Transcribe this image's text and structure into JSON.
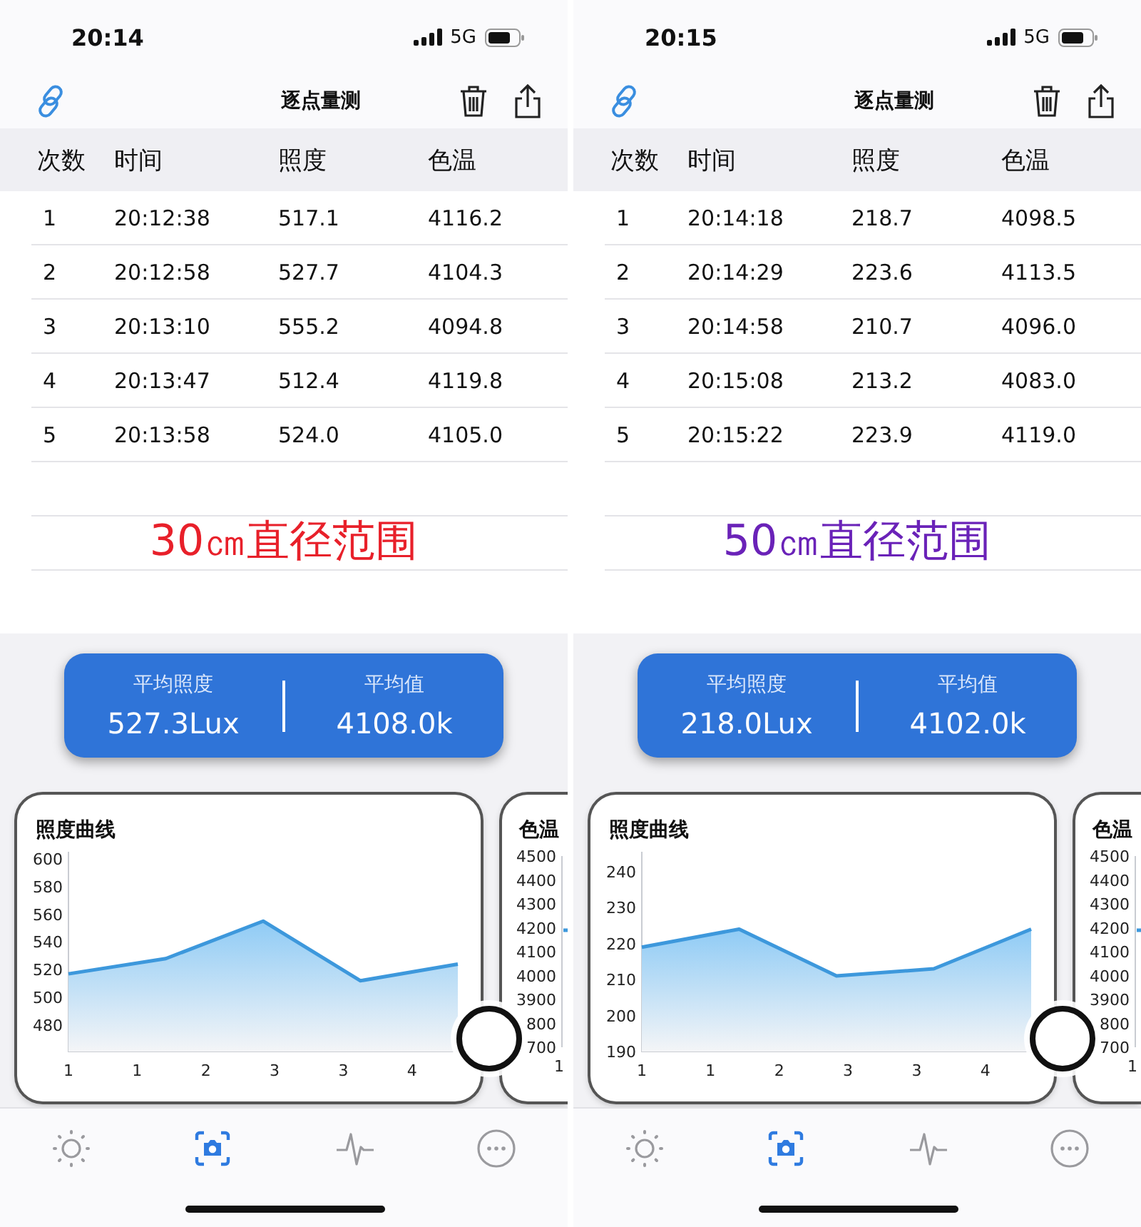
{
  "phones": [
    {
      "status": {
        "time": "20:14",
        "network": "5G"
      },
      "nav": {
        "title": "逐点量测"
      },
      "table": {
        "columns": [
          "次数",
          "时间",
          "照度",
          "色温"
        ],
        "rows": [
          [
            "1",
            "20:12:38",
            "517.1",
            "4116.2"
          ],
          [
            "2",
            "20:12:58",
            "527.7",
            "4104.3"
          ],
          [
            "3",
            "20:13:10",
            "555.2",
            "4094.8"
          ],
          [
            "4",
            "20:13:47",
            "512.4",
            "4119.8"
          ],
          [
            "5",
            "20:13:58",
            "524.0",
            "4105.0"
          ]
        ]
      },
      "caption": {
        "text": "30㎝直径范围",
        "color": "#e8202a"
      },
      "summary": [
        {
          "label": "平均照度",
          "value": "527.3Lux"
        },
        {
          "label": "平均值",
          "value": "4108.0k"
        }
      ],
      "cards": [
        {
          "title": "照度曲线",
          "chart_data": {
            "type": "area",
            "x": [
              0.8,
              1.65,
              2.5,
              3.35,
              4.2
            ],
            "values": [
              517,
              528,
              555,
              512,
              524
            ],
            "xlim": [
              0.8,
              4.2
            ],
            "ylim": [
              461,
              605
            ],
            "xticks": [
              {
                "value": 0.8,
                "label": "1"
              },
              {
                "value": 1.4,
                "label": "1"
              },
              {
                "value": 2.0,
                "label": "2"
              },
              {
                "value": 2.6,
                "label": "3"
              },
              {
                "value": 3.2,
                "label": "3"
              },
              {
                "value": 3.8,
                "label": "4"
              }
            ],
            "yticks": [
              480,
              500,
              520,
              540,
              560,
              580,
              600
            ]
          }
        },
        {
          "title": "色温",
          "axis_labels": [
            "4500",
            "4400",
            "4300",
            "4200",
            "4100",
            "4000",
            "3900",
            "800",
            "700"
          ],
          "x_label": "1"
        }
      ],
      "tabs": [
        {
          "kind": "sun",
          "selected": false
        },
        {
          "kind": "camera",
          "selected": true
        },
        {
          "kind": "pulse",
          "selected": false
        },
        {
          "kind": "more",
          "selected": false
        }
      ]
    },
    {
      "status": {
        "time": "20:15",
        "network": "5G"
      },
      "nav": {
        "title": "逐点量测"
      },
      "table": {
        "columns": [
          "次数",
          "时间",
          "照度",
          "色温"
        ],
        "rows": [
          [
            "1",
            "20:14:18",
            "218.7",
            "4098.5"
          ],
          [
            "2",
            "20:14:29",
            "223.6",
            "4113.5"
          ],
          [
            "3",
            "20:14:58",
            "210.7",
            "4096.0"
          ],
          [
            "4",
            "20:15:08",
            "213.2",
            "4083.0"
          ],
          [
            "5",
            "20:15:22",
            "223.9",
            "4119.0"
          ]
        ]
      },
      "caption": {
        "text": "50㎝直径范围",
        "color": "#6a22b8"
      },
      "summary": [
        {
          "label": "平均照度",
          "value": "218.0Lux"
        },
        {
          "label": "平均值",
          "value": "4102.0k"
        }
      ],
      "cards": [
        {
          "title": "照度曲线",
          "chart_data": {
            "type": "area",
            "x": [
              0.8,
              1.65,
              2.5,
              3.35,
              4.2
            ],
            "values": [
              219,
              224,
              211,
              213,
              224
            ],
            "xlim": [
              0.8,
              4.2
            ],
            "ylim": [
              190,
              245.5
            ],
            "xticks": [
              {
                "value": 0.8,
                "label": "1"
              },
              {
                "value": 1.4,
                "label": "1"
              },
              {
                "value": 2.0,
                "label": "2"
              },
              {
                "value": 2.6,
                "label": "3"
              },
              {
                "value": 3.2,
                "label": "3"
              },
              {
                "value": 3.8,
                "label": "4"
              }
            ],
            "yticks": [
              190,
              200,
              210,
              220,
              230,
              240
            ]
          }
        },
        {
          "title": "色温",
          "axis_labels": [
            "4500",
            "4400",
            "4300",
            "4200",
            "4100",
            "4000",
            "3900",
            "800",
            "700"
          ],
          "x_label": "1"
        }
      ],
      "tabs": [
        {
          "kind": "sun",
          "selected": false
        },
        {
          "kind": "camera",
          "selected": true
        },
        {
          "kind": "pulse",
          "selected": false
        },
        {
          "kind": "more",
          "selected": false
        }
      ]
    }
  ]
}
